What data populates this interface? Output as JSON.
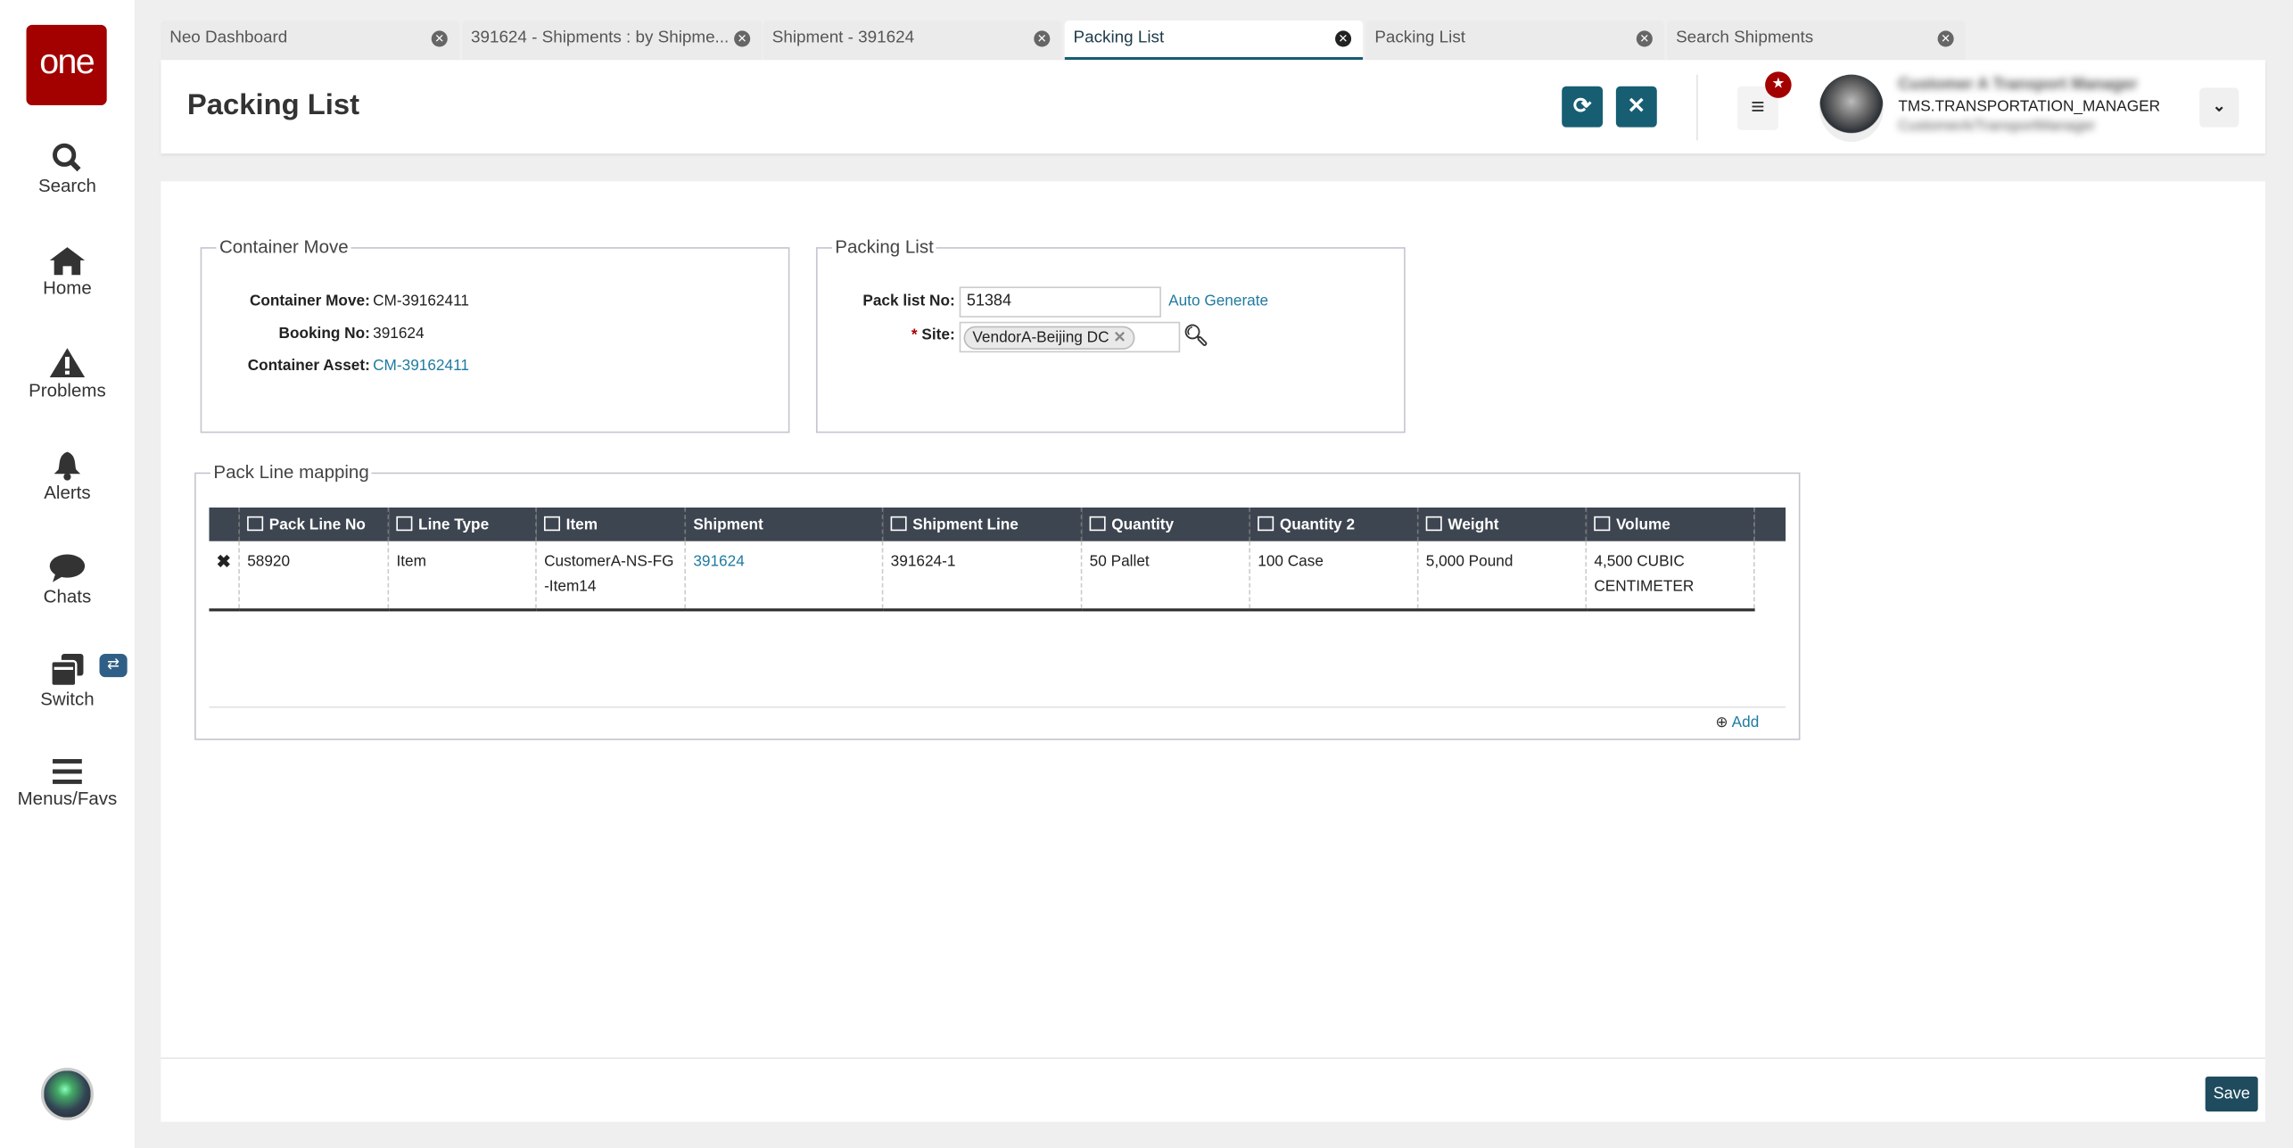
{
  "sidebar": {
    "logo": "one",
    "items": [
      {
        "label": "Search"
      },
      {
        "label": "Home"
      },
      {
        "label": "Problems"
      },
      {
        "label": "Alerts"
      },
      {
        "label": "Chats"
      },
      {
        "label": "Switch"
      },
      {
        "label": "Menus/Favs"
      }
    ],
    "switch_badge": "⇄"
  },
  "tabs": [
    {
      "label": "Neo Dashboard"
    },
    {
      "label": "391624 - Shipments : by Shipme..."
    },
    {
      "label": "Shipment - 391624"
    },
    {
      "label": "Packing List"
    },
    {
      "label": "Packing List"
    },
    {
      "label": "Search Shipments"
    }
  ],
  "header": {
    "title": "Packing List",
    "user_name": "Customer A Transport Manager",
    "user_role": "TMS.TRANSPORTATION_MANAGER",
    "user_org": "CustomerA/TransportManager"
  },
  "container_move": {
    "legend": "Container Move",
    "fields": [
      {
        "label": "Container Move:",
        "value": "CM-39162411"
      },
      {
        "label": "Booking No:",
        "value": "391624"
      },
      {
        "label": "Container Asset:",
        "value": "CM-39162411"
      }
    ]
  },
  "packing_list": {
    "legend": "Packing List",
    "pack_list_no_label": "Pack list No:",
    "pack_list_no": "51384",
    "auto_generate": "Auto Generate",
    "site_required": "*",
    "site_label": "Site:",
    "site_value": "VendorA-Beijing DC"
  },
  "pack_line": {
    "legend": "Pack Line mapping",
    "columns": [
      "Pack Line No",
      "Line Type",
      "Item",
      "Shipment",
      "Shipment Line",
      "Quantity",
      "Quantity 2",
      "Weight",
      "Volume"
    ],
    "rows": [
      {
        "pack_line_no": "58920",
        "line_type": "Item",
        "item": "CustomerA-NS-FG-Item14",
        "shipment": "391624",
        "shipment_line": "391624-1",
        "quantity": "50 Pallet",
        "quantity2": "100 Case",
        "weight": "5,000 Pound",
        "volume": "4,500 CUBIC CENTIMETER"
      }
    ],
    "add_label": "Add"
  },
  "footer": {
    "save_label": "Save"
  }
}
